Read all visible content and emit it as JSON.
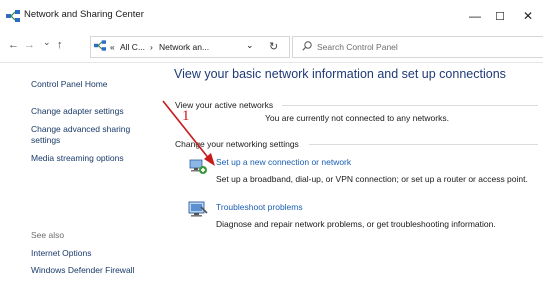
{
  "window": {
    "title": "Network and Sharing Center",
    "minimize_glyph": "—",
    "maximize_glyph": "☐",
    "close_glyph": "✕"
  },
  "navbar": {
    "back_icon": "back-arrow-icon",
    "forward_icon": "forward-arrow-icon",
    "recent_icon": "chevron-down-icon",
    "up_icon": "up-arrow-icon",
    "back_glyph": "←",
    "forward_glyph": "→",
    "recent_glyph": "⌄",
    "up_glyph": "↑",
    "overflow_glyph": "«",
    "crumbs": [
      "All C...",
      "Network an..."
    ],
    "separator": "›",
    "dropdown_glyph": "⌄",
    "refresh_glyph": "↻",
    "search_placeholder": "Search Control Panel"
  },
  "sidebar": {
    "home": "Control Panel Home",
    "items": [
      "Change adapter settings",
      "Change advanced sharing",
      "settings",
      "Media streaming options"
    ],
    "see_also_title": "See also",
    "see_also_items": [
      "Internet Options",
      "Windows Defender Firewall"
    ]
  },
  "main": {
    "heading": "View your basic network information and set up connections",
    "active_networks_label": "View your active networks",
    "not_connected_text": "You are currently not connected to any networks.",
    "change_settings_label": "Change your networking settings",
    "tasks": [
      {
        "title": "Set up a new connection or network",
        "description": "Set up a broadband, dial-up, or VPN connection; or set up a router or access point.",
        "icon": "network-setup-icon"
      },
      {
        "title": "Troubleshoot problems",
        "description": "Diagnose and repair network problems, or get troubleshooting information.",
        "icon": "troubleshoot-icon"
      }
    ]
  },
  "annotation": {
    "number": "1",
    "color": "#c8191b"
  },
  "colors": {
    "heading": "#1e3a78",
    "link": "#1a5fb4",
    "sidebar_link": "#1a3a6a"
  }
}
